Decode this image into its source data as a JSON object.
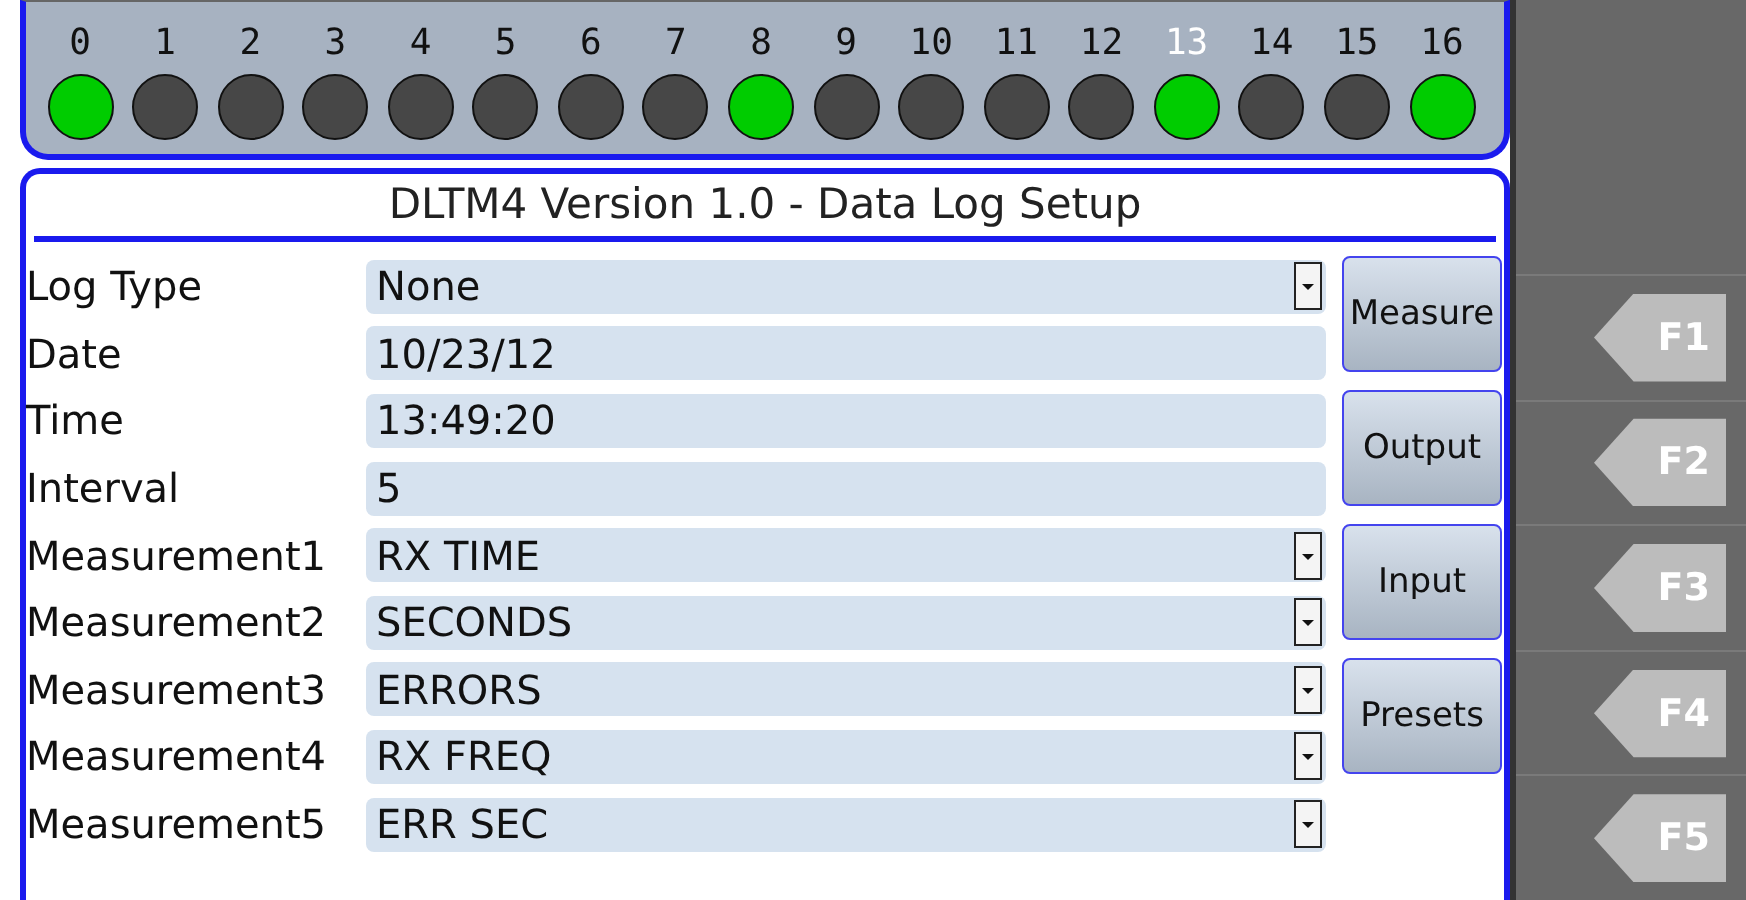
{
  "channels": [
    {
      "label": "0",
      "on": true,
      "selected": false
    },
    {
      "label": "1",
      "on": false,
      "selected": false
    },
    {
      "label": "2",
      "on": false,
      "selected": false
    },
    {
      "label": "3",
      "on": false,
      "selected": false
    },
    {
      "label": "4",
      "on": false,
      "selected": false
    },
    {
      "label": "5",
      "on": false,
      "selected": false
    },
    {
      "label": "6",
      "on": false,
      "selected": false
    },
    {
      "label": "7",
      "on": false,
      "selected": false
    },
    {
      "label": "8",
      "on": true,
      "selected": false
    },
    {
      "label": "9",
      "on": false,
      "selected": false
    },
    {
      "label": "10",
      "on": false,
      "selected": false
    },
    {
      "label": "11",
      "on": false,
      "selected": false
    },
    {
      "label": "12",
      "on": false,
      "selected": false
    },
    {
      "label": "13",
      "on": true,
      "selected": true
    },
    {
      "label": "14",
      "on": false,
      "selected": false
    },
    {
      "label": "15",
      "on": false,
      "selected": false
    },
    {
      "label": "16",
      "on": true,
      "selected": false
    }
  ],
  "title": "DLTM4 Version 1.0 - Data Log Setup",
  "fields": [
    {
      "label": "Log Type",
      "value": "None",
      "kind": "dropdown"
    },
    {
      "label": "Date",
      "value": "10/23/12",
      "kind": "text"
    },
    {
      "label": "Time",
      "value": "13:49:20",
      "kind": "text"
    },
    {
      "label": "Interval",
      "value": "5",
      "kind": "text"
    },
    {
      "label": "Measurement1",
      "value": "RX TIME",
      "kind": "dropdown"
    },
    {
      "label": "Measurement2",
      "value": "SECONDS",
      "kind": "dropdown"
    },
    {
      "label": "Measurement3",
      "value": "ERRORS",
      "kind": "dropdown"
    },
    {
      "label": "Measurement4",
      "value": "RX FREQ",
      "kind": "dropdown"
    },
    {
      "label": "Measurement5",
      "value": "ERR SEC",
      "kind": "dropdown"
    }
  ],
  "buttons": [
    "Measure",
    "Output",
    "Input",
    "Presets"
  ],
  "function_keys": [
    "F1",
    "F2",
    "F3",
    "F4",
    "F5"
  ]
}
